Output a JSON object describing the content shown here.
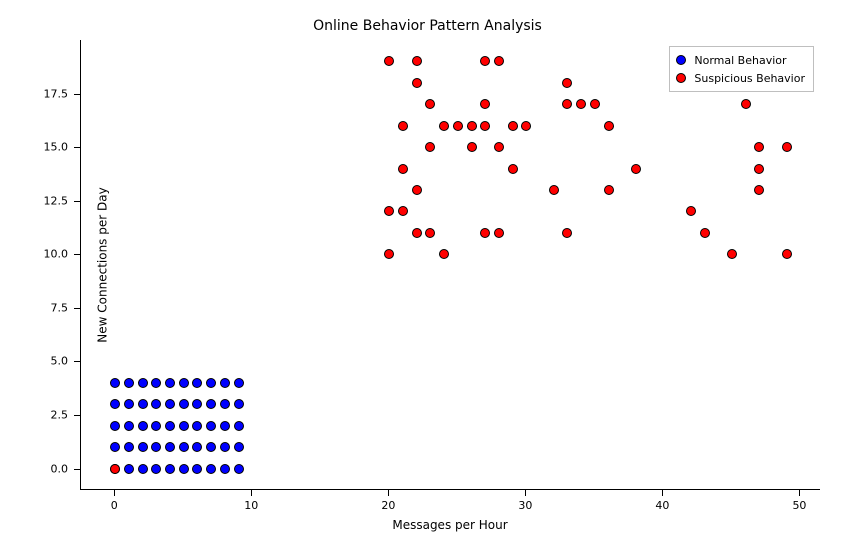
{
  "chart_data": {
    "type": "scatter",
    "title": "Online Behavior Pattern Analysis",
    "xlabel": "Messages per Hour",
    "ylabel": "New Connections per Day",
    "xlim": [
      -2.5,
      51.5
    ],
    "ylim": [
      -1.0,
      20.0
    ],
    "xticks": [
      0,
      10,
      20,
      30,
      40,
      50
    ],
    "yticks": [
      0.0,
      2.5,
      5.0,
      7.5,
      10.0,
      12.5,
      15.0,
      17.5
    ],
    "legend": {
      "position": "upper right"
    },
    "colors": {
      "normal": "#0000ff",
      "suspicious": "#ff0000"
    },
    "series": [
      {
        "name": "Normal Behavior",
        "color": "#0000ff",
        "points": [
          [
            0,
            0
          ],
          [
            1,
            0
          ],
          [
            2,
            0
          ],
          [
            3,
            0
          ],
          [
            4,
            0
          ],
          [
            5,
            0
          ],
          [
            6,
            0
          ],
          [
            7,
            0
          ],
          [
            8,
            0
          ],
          [
            9,
            0
          ],
          [
            0,
            1
          ],
          [
            1,
            1
          ],
          [
            2,
            1
          ],
          [
            3,
            1
          ],
          [
            4,
            1
          ],
          [
            5,
            1
          ],
          [
            6,
            1
          ],
          [
            7,
            1
          ],
          [
            8,
            1
          ],
          [
            9,
            1
          ],
          [
            0,
            2
          ],
          [
            1,
            2
          ],
          [
            2,
            2
          ],
          [
            3,
            2
          ],
          [
            4,
            2
          ],
          [
            5,
            2
          ],
          [
            6,
            2
          ],
          [
            7,
            2
          ],
          [
            8,
            2
          ],
          [
            9,
            2
          ],
          [
            0,
            3
          ],
          [
            1,
            3
          ],
          [
            2,
            3
          ],
          [
            3,
            3
          ],
          [
            4,
            3
          ],
          [
            5,
            3
          ],
          [
            6,
            3
          ],
          [
            7,
            3
          ],
          [
            8,
            3
          ],
          [
            9,
            3
          ],
          [
            0,
            4
          ],
          [
            1,
            4
          ],
          [
            2,
            4
          ],
          [
            3,
            4
          ],
          [
            4,
            4
          ],
          [
            5,
            4
          ],
          [
            6,
            4
          ],
          [
            7,
            4
          ],
          [
            8,
            4
          ],
          [
            9,
            4
          ]
        ]
      },
      {
        "name": "Suspicious Behavior",
        "color": "#ff0000",
        "points": [
          [
            0,
            0
          ],
          [
            20,
            10
          ],
          [
            20,
            12
          ],
          [
            20,
            19
          ],
          [
            21,
            12
          ],
          [
            21,
            14
          ],
          [
            21,
            16
          ],
          [
            22,
            11
          ],
          [
            22,
            13
          ],
          [
            22,
            18
          ],
          [
            22,
            19
          ],
          [
            23,
            11
          ],
          [
            23,
            15
          ],
          [
            23,
            17
          ],
          [
            24,
            10
          ],
          [
            24,
            16
          ],
          [
            25,
            16
          ],
          [
            26,
            15
          ],
          [
            26,
            16
          ],
          [
            27,
            11
          ],
          [
            27,
            16
          ],
          [
            27,
            17
          ],
          [
            27,
            19
          ],
          [
            28,
            11
          ],
          [
            28,
            15
          ],
          [
            28,
            19
          ],
          [
            29,
            14
          ],
          [
            29,
            16
          ],
          [
            30,
            16
          ],
          [
            32,
            13
          ],
          [
            33,
            11
          ],
          [
            33,
            17
          ],
          [
            33,
            18
          ],
          [
            34,
            17
          ],
          [
            35,
            17
          ],
          [
            36,
            13
          ],
          [
            36,
            16
          ],
          [
            38,
            14
          ],
          [
            42,
            12
          ],
          [
            43,
            11
          ],
          [
            45,
            10
          ],
          [
            46,
            17
          ],
          [
            47,
            13
          ],
          [
            47,
            14
          ],
          [
            47,
            15
          ],
          [
            49,
            10
          ],
          [
            49,
            15
          ]
        ]
      }
    ]
  }
}
